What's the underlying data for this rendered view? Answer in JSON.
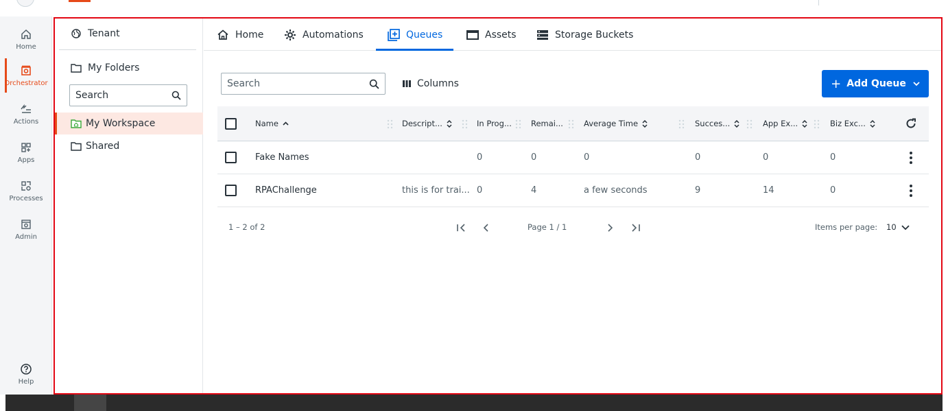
{
  "rail": {
    "items": [
      {
        "label": "Home",
        "icon": "home-icon"
      },
      {
        "label": "Orchestrator",
        "icon": "orchestrator-icon",
        "active": true
      },
      {
        "label": "Actions",
        "icon": "actions-icon"
      },
      {
        "label": "Apps",
        "icon": "apps-icon"
      },
      {
        "label": "Processes",
        "icon": "processes-icon"
      },
      {
        "label": "Admin",
        "icon": "admin-icon"
      }
    ],
    "help_label": "Help"
  },
  "folders": {
    "tenant_label": "Tenant",
    "my_folders_label": "My Folders",
    "search_placeholder": "Search",
    "workspace_label": "My Workspace",
    "shared_label": "Shared"
  },
  "tabs": [
    {
      "label": "Home",
      "icon": "home-icon"
    },
    {
      "label": "Automations",
      "icon": "automations-icon"
    },
    {
      "label": "Queues",
      "icon": "queues-icon",
      "active": true
    },
    {
      "label": "Assets",
      "icon": "assets-icon"
    },
    {
      "label": "Storage Buckets",
      "icon": "storage-icon"
    }
  ],
  "toolbar": {
    "search_placeholder": "Search",
    "columns_label": "Columns",
    "add_label": "Add Queue"
  },
  "grid": {
    "headers": [
      "Name",
      "Descript...",
      "In Prog...",
      "Remai...",
      "Average Time",
      "Succes...",
      "App Ex...",
      "Biz Exc..."
    ],
    "rows": [
      {
        "name": "Fake Names",
        "description": "",
        "in_progress": "0",
        "remaining": "0",
        "average_time": "0",
        "successful": "0",
        "app_exceptions": "0",
        "biz_exceptions": "0"
      },
      {
        "name": "RPAChallenge",
        "description": "this is for trai...",
        "in_progress": "0",
        "remaining": "4",
        "average_time": "a few seconds",
        "successful": "9",
        "app_exceptions": "14",
        "biz_exceptions": "0"
      }
    ]
  },
  "pager": {
    "range": "1 – 2 of 2",
    "page_text": "Page 1 / 1",
    "items_per_page_label": "Items per page:",
    "items_per_page_value": "10"
  },
  "colors": {
    "accent": "#0067df",
    "brand": "#e64a19",
    "frame": "#e30613"
  }
}
